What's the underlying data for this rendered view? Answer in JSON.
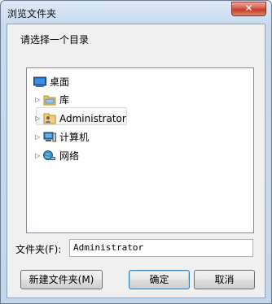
{
  "window": {
    "title": "浏览文件夹",
    "close_label": "✕"
  },
  "prompt": "请选择一个目录",
  "tree": {
    "items": [
      {
        "label": "桌面",
        "icon": "desktop-icon"
      },
      {
        "label": "库",
        "icon": "library-folder-icon"
      },
      {
        "label": "Administrator",
        "icon": "user-folder-icon",
        "selected": true
      },
      {
        "label": "计算机",
        "icon": "computer-icon"
      },
      {
        "label": "网络",
        "icon": "network-icon"
      }
    ],
    "expander_glyph": "▷"
  },
  "folder": {
    "label": "文件夹(F):",
    "value": "Administrator"
  },
  "buttons": {
    "new_folder": "新建文件夹(M)",
    "ok": "确定",
    "cancel": "取消"
  }
}
